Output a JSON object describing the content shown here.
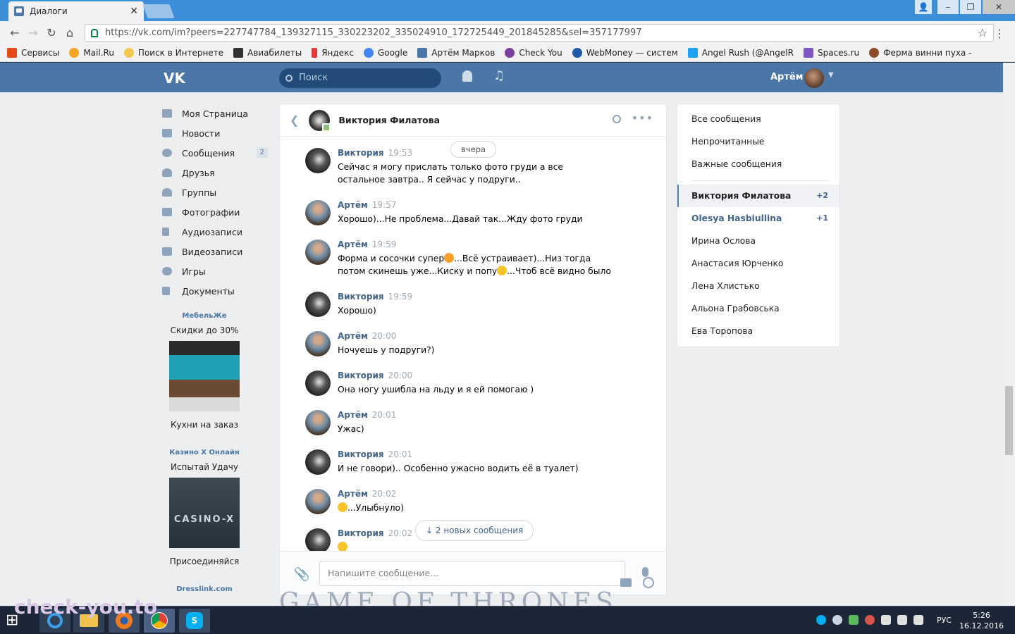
{
  "browser": {
    "tab_title": "Диалоги",
    "url": "https://vk.com/im?peers=227747784_139327115_330223202_335024910_172725449_201845285&sel=357177997"
  },
  "bookmarks": [
    {
      "label": "Сервисы",
      "color": "#e64a19"
    },
    {
      "label": "Mail.Ru",
      "color": "#f5a623"
    },
    {
      "label": "Поиск в Интернете",
      "color": "#f2c94c"
    },
    {
      "label": "Авиабилеты",
      "color": "#333333"
    },
    {
      "label": "Яндекс",
      "color": "#e53935"
    },
    {
      "label": "Google",
      "color": "#4285f4"
    },
    {
      "label": "Артём Марков",
      "color": "#4a76a8"
    },
    {
      "label": "Check You",
      "color": "#7b3fa0"
    },
    {
      "label": "WebMoney — систем",
      "color": "#1e5aa8"
    },
    {
      "label": "Angel Rush (@AngelR",
      "color": "#1da1f2"
    },
    {
      "label": "Spaces.ru",
      "color": "#7e57c2"
    },
    {
      "label": "Ферма винни пуха -",
      "color": "#8d4b2a"
    }
  ],
  "vk": {
    "logo": "VK",
    "search_placeholder": "Поиск",
    "user_name": "Артём"
  },
  "nav": [
    {
      "label": "Моя Страница"
    },
    {
      "label": "Новости"
    },
    {
      "label": "Сообщения",
      "badge": "2"
    },
    {
      "label": "Друзья"
    },
    {
      "label": "Группы"
    },
    {
      "label": "Фотографии"
    },
    {
      "label": "Аудиозаписи"
    },
    {
      "label": "Видеозаписи"
    },
    {
      "label": "Игры"
    },
    {
      "label": "Документы"
    }
  ],
  "ads": [
    {
      "title": "МебельЖе",
      "subtitle": "Скидки до 30%",
      "caption": "Кухни на заказ"
    },
    {
      "title": "Казино X Онлайн",
      "subtitle": "Испытай Удачу",
      "caption": "Присоединяйся",
      "image_text": "CASINO-X"
    },
    {
      "title": "Dresslink.com"
    }
  ],
  "chat": {
    "title": "Виктория Филатова",
    "day_label": "вчера",
    "new_messages_label": "2 новых сообщения",
    "composer_placeholder": "Напишите сообщение...",
    "messages": [
      {
        "author": "Виктория",
        "time": "19:53",
        "text": "Сейчас я могу прислать только фото груди а все остальное завтра.. Я сейчас у подруги..",
        "avatar": "v"
      },
      {
        "author": "Артём",
        "time": "19:57",
        "text": "Хорошо)...Не проблема...Давай так...Жду фото груди",
        "avatar": "a"
      },
      {
        "author": "Артём",
        "time": "19:59",
        "text": "Форма и сосочки супер",
        "text2": "...Всё устраивает)...Низ тогда потом скинешь уже...Киску и попу",
        "text3": "...Чтоб всё видно было",
        "avatar": "a"
      },
      {
        "author": "Виктория",
        "time": "19:59",
        "text": "Хорошо)",
        "avatar": "v"
      },
      {
        "author": "Артём",
        "time": "20:00",
        "text": "Ночуешь у подруги?)",
        "avatar": "a"
      },
      {
        "author": "Виктория",
        "time": "20:00",
        "text": "Она ногу ушибла на льду и я ей помогаю )",
        "avatar": "v"
      },
      {
        "author": "Артём",
        "time": "20:01",
        "text": "Ужас)",
        "avatar": "a"
      },
      {
        "author": "Виктория",
        "time": "20:01",
        "text": "И не говори).. Особенно ужасно водить её в туалет)",
        "avatar": "v"
      },
      {
        "author": "Артём",
        "time": "20:02",
        "text": "...Улыбнуло)",
        "avatar": "a"
      },
      {
        "author": "Виктория",
        "time": "20:02",
        "text": "",
        "avatar": "v"
      }
    ]
  },
  "right_panel": {
    "filters": [
      "Все сообщения",
      "Непрочитанные",
      "Важные сообщения"
    ],
    "conversations": [
      {
        "name": "Виктория Филатова",
        "count": "+2",
        "state": "active"
      },
      {
        "name": "Olesya Hasbiullina",
        "count": "+1",
        "state": "unread"
      },
      {
        "name": "Ирина Ослова",
        "count": ""
      },
      {
        "name": "Анастасия Юрченко",
        "count": ""
      },
      {
        "name": "Лена Хлистько",
        "count": ""
      },
      {
        "name": "Альона Грабовська",
        "count": ""
      },
      {
        "name": "Ева Торопова",
        "count": ""
      }
    ]
  },
  "background_text": "GAME OF THRONES",
  "watermark": "check-you.to",
  "taskbar": {
    "language": "РУС",
    "time": "5:26",
    "date": "16.12.2016"
  }
}
